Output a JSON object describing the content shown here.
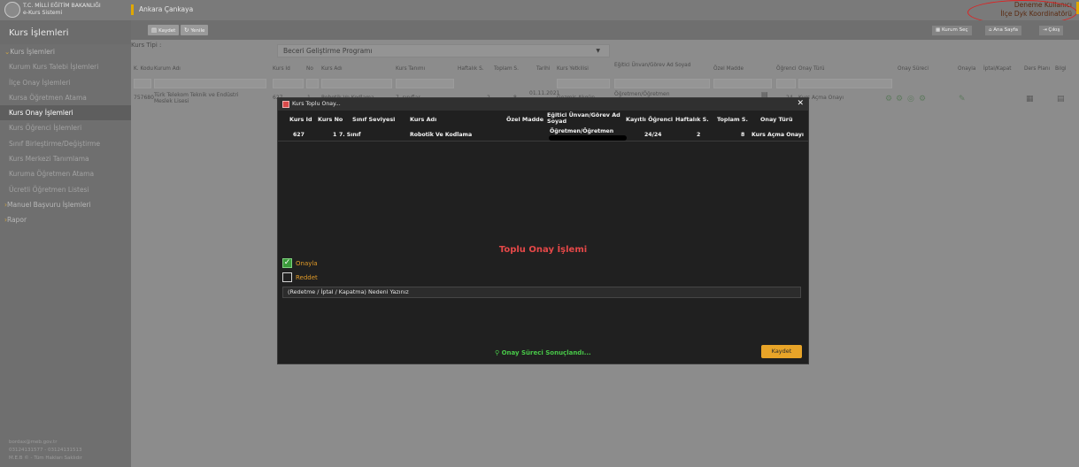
{
  "header": {
    "ministry": "T.C. MİLLİ EĞİTİM BAKANLIĞI",
    "system": "e-Kurs Sistemi",
    "location": "Ankara Çankaya",
    "user_name": "Deneme Kullanıcı",
    "user_role": "İlçe Dyk Koordinatörü",
    "annotation_color": "#e02020"
  },
  "sidebar": {
    "title": "Kurs İşlemleri",
    "items": [
      {
        "label": "Kurs İşlemleri",
        "head": true
      },
      {
        "label": "Kurum Kurs Talebi İşlemleri"
      },
      {
        "label": "İlçe Onay İşlemleri"
      },
      {
        "label": "Kursa Öğretmen Atama"
      },
      {
        "label": "Kurs Onay İşlemleri",
        "active": true
      },
      {
        "label": "Kurs Öğrenci İşlemleri"
      },
      {
        "label": "Sınıf Birleştirme/Değiştirme"
      },
      {
        "label": "Kurs Merkezi Tanımlama"
      },
      {
        "label": "Kuruma Öğretmen Atama"
      },
      {
        "label": "Ücretli Öğretmen Listesi"
      },
      {
        "label": "Manuel Başvuru İşlemleri",
        "head": true
      },
      {
        "label": "Rapor",
        "head": true
      }
    ],
    "footer": [
      "bordax@meb.gov.tr",
      "03124131577 - 03124131513",
      "M.E.B © - Tüm Hakları Saklıdır"
    ]
  },
  "toolbar": {
    "save": "Kaydet",
    "refresh": "Yenile",
    "school_select": "Kurum Seç",
    "home": "Ana Sayfa",
    "logout": "Çıkış"
  },
  "main": {
    "filter_label": "Kurs Tipi :",
    "course_type": "Beceri Geliştirme Programı",
    "columns": [
      "K. Kodu",
      "Kurum Adı",
      "Kurs Id",
      "No",
      "Kurs Adı",
      "Kurs Tanımı",
      "Haftalık S.",
      "Toplam S.",
      "Tarihi",
      "Kurs Yetkilisi",
      "Eğitici Ünvan/Görev Ad Soyad",
      "Özel Madde",
      "Öğrenci",
      "Onay Türü",
      "Onay Süreci",
      "Onayla",
      "İptal/Kapat",
      "Ders Planı",
      "Bilgi"
    ],
    "row": {
      "code": "757680",
      "school": "Türk Telekom Teknik ve Endüstri Meslek Lisesi",
      "course_id": "627",
      "no": "1",
      "course_name": "Robotik Ve Kodlama",
      "definition": "7. sınıflar",
      "weekly": "2",
      "total": "8",
      "date": "01.11.2021",
      "official": "Gezmiş Akgün",
      "teacher_title": "Öğretmen/Öğretmen",
      "students": "24",
      "approval_type": "Kurs Açma Onayı"
    }
  },
  "modal": {
    "title": "Kurs Toplu Onay...",
    "columns": [
      "Kurs Id",
      "Kurs No",
      "Sınıf Seviyesi",
      "Kurs Adı",
      "Özel Madde",
      "Eğitici Ünvan/Görev Ad Soyad",
      "Kayıtlı Öğrenci",
      "Haftalık S.",
      "Toplam S.",
      "Onay Türü"
    ],
    "row": {
      "course_id": "627",
      "course_no": "1",
      "grade": "7. Sınıf",
      "course_name": "Robotik Ve Kodlama",
      "teacher": "Öğretmen/Öğretmen",
      "students": "24/24",
      "weekly": "2",
      "total": "8",
      "approval_type": "Kurs Açma Onayı"
    },
    "section_title": "Toplu Onay İşlemi",
    "approve_label": "Onayla",
    "approve_checked": true,
    "reject_label": "Reddet",
    "reject_checked": false,
    "reason_value": "(Redetme / İptal / Kapatma) Nedeni Yazınız",
    "status": "Onay Süreci Sonuçlandı...",
    "save": "Kaydet"
  }
}
